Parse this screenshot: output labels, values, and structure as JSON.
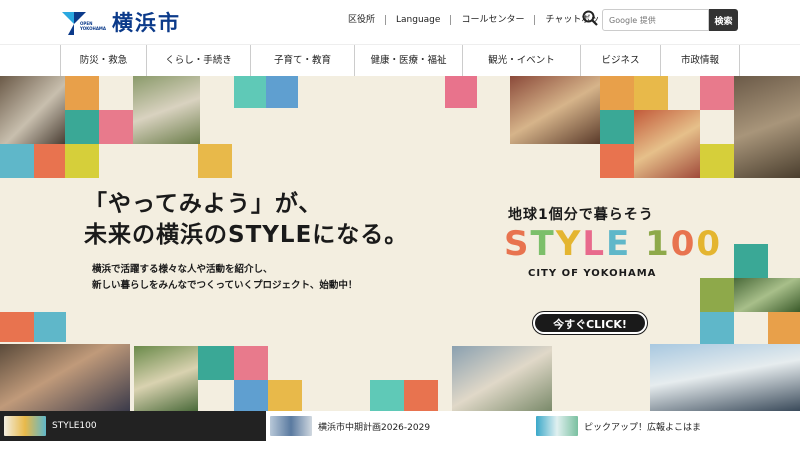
{
  "header": {
    "logo_text": "横浜市",
    "logo_small": "OPEN YOKOHAMA",
    "util_links": [
      "区役所",
      "Language",
      "コールセンター",
      "チャットボット"
    ],
    "search_placeholder": "Google 提供",
    "search_button": "検索"
  },
  "gnav": {
    "items": [
      "防災・救急",
      "くらし・手続き",
      "子育て・教育",
      "健康・医療・福祉",
      "観光・イベント",
      "ビジネス",
      "市政情報"
    ]
  },
  "hero": {
    "headline_1": "「やってみよう」が、",
    "headline_2": "未来の横浜のSTYLEになる。",
    "subcopy_1": "横浜で活躍する様々な人や活動を紹介し、",
    "subcopy_2": "新しい暮らしをみんなでつくっていくプロジェクト、始動中！",
    "tagline": "地球1個分で暮らそう",
    "style_chars": [
      "S",
      "T",
      "Y",
      "L",
      "E",
      " ",
      "1",
      "0",
      "0"
    ],
    "city": "CITY OF YOKOHAMA",
    "cta": "今すぐCLICK!"
  },
  "bottom_bar": {
    "items": [
      {
        "label": "STYLE100",
        "active": true
      },
      {
        "label": "横浜市中期計画2026-2029",
        "active": false
      },
      {
        "label": "ピックアップ！広報よこはま",
        "active": false
      }
    ]
  },
  "colors": {
    "brand_navy": "#0b3a8a",
    "hero_bg": "#f3eee0",
    "dark": "#222222"
  }
}
